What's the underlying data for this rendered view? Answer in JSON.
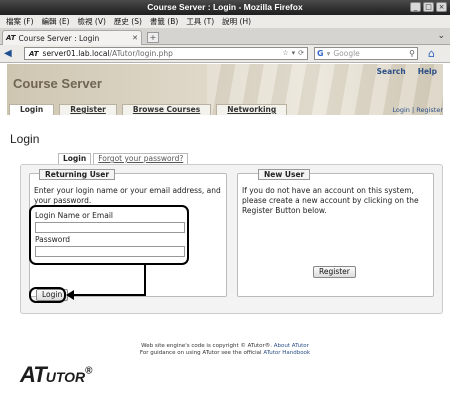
{
  "window": {
    "title": "Course Server : Login - Mozilla Firefox"
  },
  "menu": [
    "檔案 (F)",
    "編輯 (E)",
    "檢視 (V)",
    "歷史 (S)",
    "書籤 (B)",
    "工具 (T)",
    "說明 (H)"
  ],
  "browser": {
    "tab_title": "Course Server : Login",
    "tab_icon": "AT",
    "url_host": "server01.lab.local",
    "url_path": "/ATutor/login.php",
    "search_placeholder": "Google"
  },
  "header": {
    "site_title": "Course Server",
    "top_links": [
      "Search",
      "Help"
    ],
    "nav_tabs": [
      "Login",
      "Register",
      "Browse Courses",
      "Networking"
    ],
    "user_links": "Login | Register"
  },
  "page": {
    "title": "Login",
    "subtabs": {
      "login": "Login",
      "forgot": "Forgot your password?"
    },
    "returning_user": {
      "legend": "Returning User",
      "intro": "Enter your login name or your email address, and your password.",
      "login_label": "Login Name or Email",
      "password_label": "Password",
      "login_value": "",
      "password_value": "",
      "submit": "Login"
    },
    "new_user": {
      "legend": "New User",
      "intro": "If you do not have an account on this system, please create a new account by clicking on the Register Button below.",
      "submit": "Register"
    }
  },
  "footer": {
    "line1_text": "Web site engine's code is copyright © ATutor®.",
    "line1_link": "About ATutor",
    "line2_text": "For guidance on using ATutor see the official",
    "line2_link": "ATutor Handbook"
  },
  "brand": {
    "a": "AT",
    "b": "UTOR",
    "mark": "®"
  }
}
